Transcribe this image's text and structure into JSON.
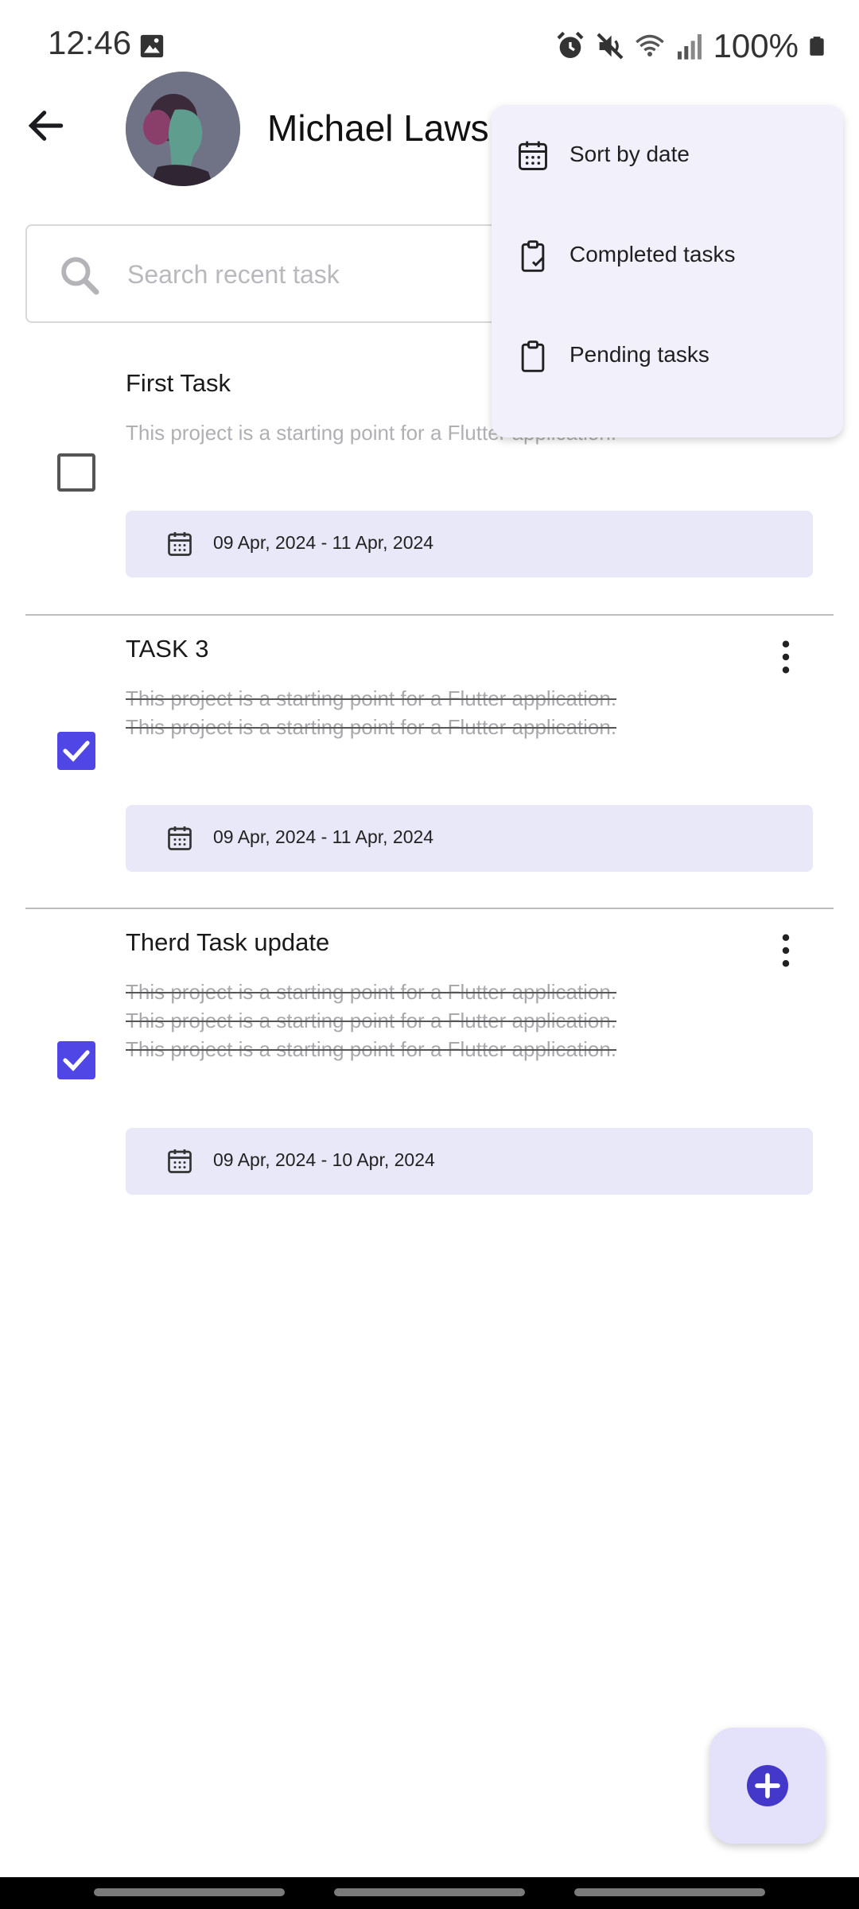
{
  "status_bar": {
    "time": "12:46",
    "battery": "100%"
  },
  "header": {
    "user_name": "Michael Laws"
  },
  "search": {
    "placeholder": "Search recent task"
  },
  "tasks": [
    {
      "title": "First Task",
      "description": "This project is a starting point for a Flutter application.",
      "completed": false,
      "date_range": "09 Apr, 2024 - 11 Apr, 2024"
    },
    {
      "title": "TASK 3",
      "description_lines": [
        "This project is a starting point for a Flutter application.",
        "This project is a starting point for a Flutter application."
      ],
      "completed": true,
      "date_range": "09 Apr, 2024 - 11 Apr, 2024"
    },
    {
      "title": "Therd Task update",
      "description_lines": [
        "This project is a starting point for a Flutter application.",
        "This project is a starting point for a Flutter application.",
        "This project is a starting point for a Flutter application."
      ],
      "completed": true,
      "date_range": "09 Apr, 2024 - 10 Apr, 2024"
    }
  ],
  "menu": {
    "items": [
      {
        "label": "Sort by date",
        "icon": "calendar-icon"
      },
      {
        "label": "Completed tasks",
        "icon": "clipboard-check-icon"
      },
      {
        "label": "Pending tasks",
        "icon": "clipboard-icon"
      }
    ]
  },
  "colors": {
    "accent": "#4f46e5",
    "chip_background": "#e9e8f8",
    "menu_background": "#f2f0fb",
    "fab_background": "#e4e1fb"
  }
}
